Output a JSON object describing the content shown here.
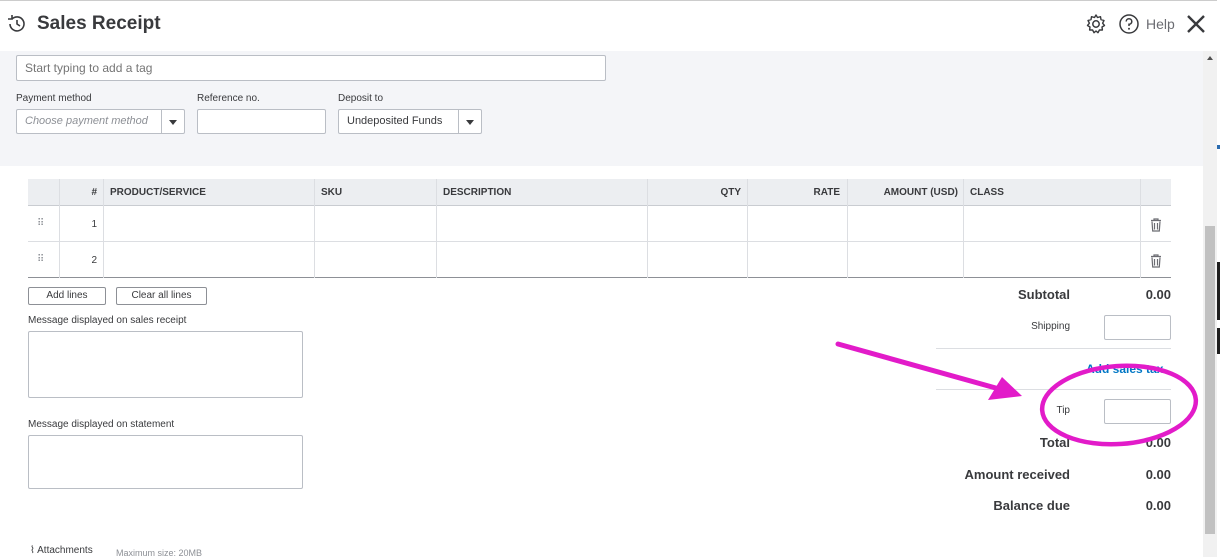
{
  "header": {
    "title": "Sales Receipt",
    "help_label": "Help"
  },
  "tags": {
    "placeholder": "Start typing to add a tag"
  },
  "payment_method": {
    "label": "Payment method",
    "placeholder": "Choose payment method"
  },
  "reference": {
    "label": "Reference no.",
    "value": ""
  },
  "deposit_to": {
    "label": "Deposit to",
    "value": "Undeposited Funds"
  },
  "table": {
    "headers": [
      "#",
      "PRODUCT/SERVICE",
      "SKU",
      "DESCRIPTION",
      "QTY",
      "RATE",
      "AMOUNT (USD)",
      "CLASS"
    ],
    "rows": [
      {
        "num": "1"
      },
      {
        "num": "2"
      }
    ]
  },
  "buttons": {
    "add_lines": "Add lines",
    "clear_all_lines": "Clear all lines"
  },
  "messages": {
    "receipt_label": "Message displayed on sales receipt",
    "statement_label": "Message displayed on statement"
  },
  "totals": {
    "subtotal_label": "Subtotal",
    "subtotal_value": "0.00",
    "shipping_label": "Shipping",
    "add_sales_tax": "Add sales tax",
    "tip_label": "Tip",
    "total_label": "Total",
    "total_value": "0.00",
    "amount_received_label": "Amount received",
    "amount_received_value": "0.00",
    "balance_due_label": "Balance due",
    "balance_due_value": "0.00"
  },
  "attachments": {
    "label": "Attachments",
    "max_size": "Maximum size: 20MB"
  },
  "colors": {
    "annotation": "#e21bc9",
    "link": "#0077c5"
  }
}
